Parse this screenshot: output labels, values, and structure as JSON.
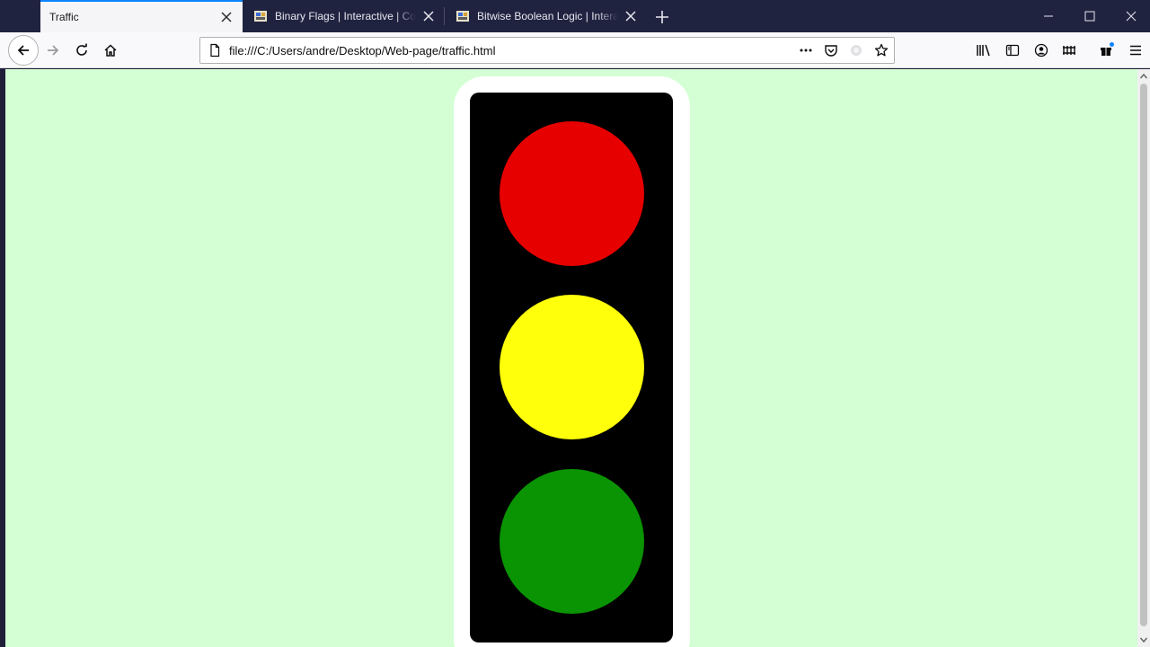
{
  "tabs": [
    {
      "title": "Traffic",
      "active": true
    },
    {
      "title": "Binary Flags | Interactive | Computer Science",
      "active": false
    },
    {
      "title": "Bitwise Boolean Logic | Interactive",
      "active": false
    }
  ],
  "navigation": {
    "url": "file:///C:/Users/andre/Desktop/Web-page/traffic.html"
  },
  "icons": {
    "back": "back-arrow-icon",
    "forward": "forward-arrow-icon",
    "reload": "reload-icon",
    "home": "home-icon",
    "page": "page-icon",
    "more": "ellipsis-icon",
    "pocket": "pocket-icon",
    "bookmark": "star-icon",
    "library": "library-icon",
    "sidebar": "sidebar-icon",
    "account": "account-icon",
    "extension": "extension-icon",
    "menu": "hamburger-menu-icon"
  },
  "traffic_light": {
    "housing_color": "#ffffff",
    "panel_color": "#000000",
    "lamps": [
      {
        "name": "red",
        "color": "#e60000"
      },
      {
        "name": "yellow",
        "color": "#ffff0b"
      },
      {
        "name": "green",
        "color": "#0a9302"
      }
    ]
  },
  "colors": {
    "page_background": "#d4ffd4",
    "tabstrip": "#202340",
    "accent": "#0a84ff"
  }
}
